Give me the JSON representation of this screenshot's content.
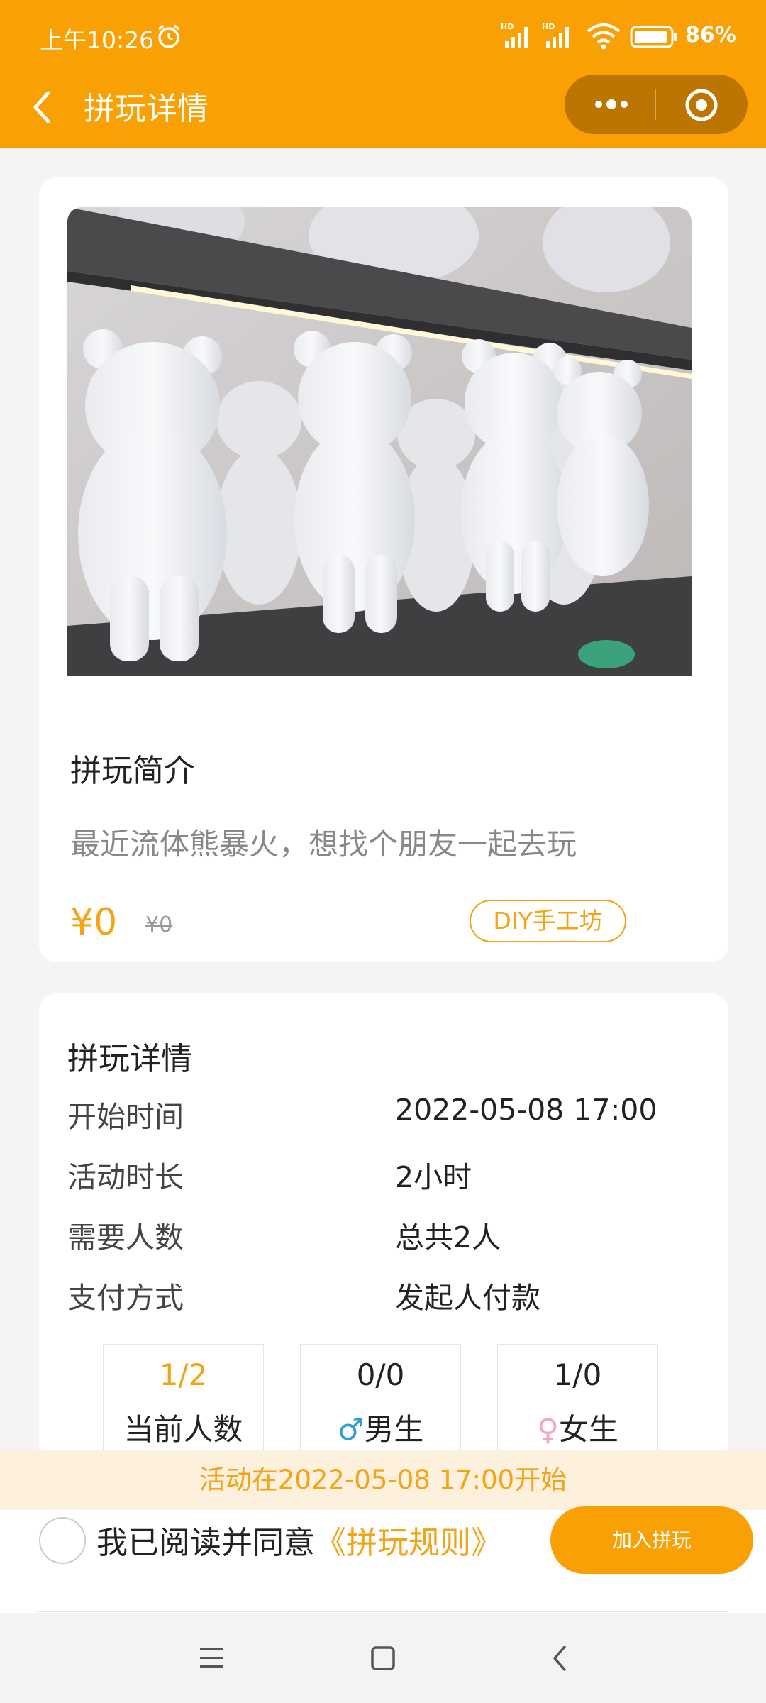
{
  "status_bar": {
    "time": "上午10:26",
    "battery": "86%"
  },
  "nav": {
    "title": "拼玩详情"
  },
  "activity": {
    "intro_title": "拼玩简介",
    "intro_text": "最近流体熊暴火，想找个朋友一起去玩",
    "price": "¥0",
    "original_price": "¥0",
    "tag": "DIY手工坊"
  },
  "details": {
    "title": "拼玩详情",
    "rows": [
      {
        "label": "开始时间",
        "value": "2022-05-08 17:00"
      },
      {
        "label": "活动时长",
        "value": "2小时"
      },
      {
        "label": "需要人数",
        "value": "总共2人"
      },
      {
        "label": "支付方式",
        "value": "发起人付款"
      }
    ],
    "stats": [
      {
        "value": "1/2",
        "label": "当前人数"
      },
      {
        "value": "0/0",
        "symbol": "♂",
        "label": "男生"
      },
      {
        "value": "1/0",
        "symbol": "♀",
        "label": "女生"
      }
    ]
  },
  "notice": "活动在2022-05-08 17:00开始",
  "footer": {
    "agree_text": "我已阅读并同意",
    "rules_link": "《拼玩规则》",
    "join_button": "加入拼玩"
  },
  "colors": {
    "accent": "#f9a005",
    "accent_text": "#f3a314",
    "notice_bg": "#fdf0dc",
    "male": "#2e9fd6",
    "female": "#f2a7c0"
  }
}
